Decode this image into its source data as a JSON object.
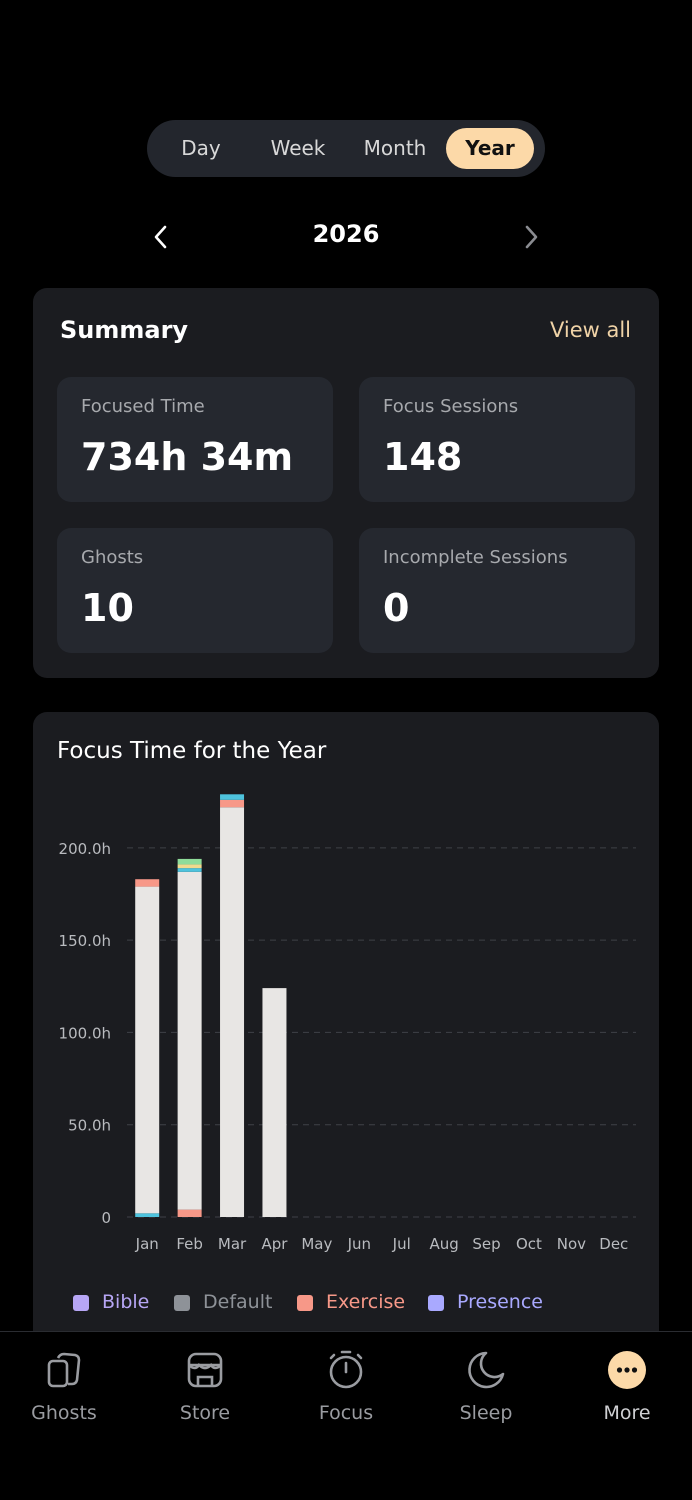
{
  "period_tabs": [
    {
      "label": "Day",
      "active": false
    },
    {
      "label": "Week",
      "active": false
    },
    {
      "label": "Month",
      "active": false
    },
    {
      "label": "Year",
      "active": true
    }
  ],
  "year_nav": {
    "label": "2026",
    "prev_icon": "chevron-left-icon",
    "next_icon": "chevron-right-icon"
  },
  "summary": {
    "title": "Summary",
    "view_all": "View all",
    "stats": [
      {
        "label": "Focused Time",
        "value": "734h 34m"
      },
      {
        "label": "Focus Sessions",
        "value": "148"
      },
      {
        "label": "Ghosts",
        "value": "10"
      },
      {
        "label": "Incomplete Sessions",
        "value": "0"
      }
    ]
  },
  "chart": {
    "title": "Focus Time for the Year"
  },
  "chart_data": {
    "type": "bar",
    "stacked": true,
    "categories": [
      "Jan",
      "Feb",
      "Mar",
      "Apr",
      "May",
      "Jun",
      "Jul",
      "Aug",
      "Sep",
      "Oct",
      "Nov",
      "Dec"
    ],
    "y_ticks": [
      "0",
      "50.0h",
      "100.0h",
      "150.0h",
      "200.0h"
    ],
    "ylim": [
      0,
      240
    ],
    "grid": true,
    "legend_position": "bottom",
    "series": [
      {
        "name": "Bible",
        "color": "#b7a6f5",
        "values": [
          2,
          1,
          0,
          0,
          0,
          0,
          0,
          0,
          0,
          0,
          0,
          0
        ]
      },
      {
        "name": "Default",
        "color": "#e8e6e4",
        "values": [
          177,
          183,
          222,
          124,
          0,
          0,
          0,
          0,
          0,
          0,
          0,
          0
        ]
      },
      {
        "name": "Exercise",
        "color": "#f79888",
        "values": [
          4,
          4,
          4,
          0,
          0,
          0,
          0,
          0,
          0,
          0,
          0,
          0
        ]
      },
      {
        "name": "Presence",
        "color": "#a9a9ff",
        "values": [
          0,
          0,
          0,
          0,
          0,
          0,
          0,
          0,
          0,
          0,
          0,
          0
        ]
      },
      {
        "name": "",
        "color": "#4ec3dd",
        "values": [
          2,
          2,
          3,
          0,
          0,
          0,
          0,
          0,
          0,
          0,
          0,
          0
        ]
      },
      {
        "name": "",
        "color": "#f1d98d",
        "values": [
          0,
          2,
          0,
          0,
          0,
          0,
          0,
          0,
          0,
          0,
          0,
          0
        ]
      },
      {
        "name": "",
        "color": "#8fdc9a",
        "values": [
          0,
          3,
          0,
          0,
          0,
          0,
          0,
          0,
          0,
          0,
          0,
          0
        ]
      }
    ],
    "stack_order": [
      [
        4,
        1,
        2
      ],
      [
        2,
        1,
        4,
        5,
        6
      ],
      [
        1,
        2,
        4
      ],
      [
        1
      ]
    ]
  },
  "legend": [
    {
      "label": "Bible",
      "color": "#b7a6f5",
      "text_color": "#b7a6f5"
    },
    {
      "label": "Default",
      "color": "#8e9298",
      "text_color": "#8e9298"
    },
    {
      "label": "Exercise",
      "color": "#f79888",
      "text_color": "#f79888"
    },
    {
      "label": "Presence",
      "color": "#a9a9ff",
      "text_color": "#a9a9ff"
    }
  ],
  "tabbar": [
    {
      "label": "Ghosts",
      "icon": "ghosts-cards-icon",
      "active": false
    },
    {
      "label": "Store",
      "icon": "store-icon",
      "active": false
    },
    {
      "label": "Focus",
      "icon": "stopwatch-icon",
      "active": false
    },
    {
      "label": "Sleep",
      "icon": "moon-icon",
      "active": false
    },
    {
      "label": "More",
      "icon": "more-icon",
      "active": true
    }
  ],
  "colors": {
    "accent": "#fcd9a8",
    "background": "#000000",
    "card": "#1b1c20",
    "stat_card": "#25282f"
  }
}
